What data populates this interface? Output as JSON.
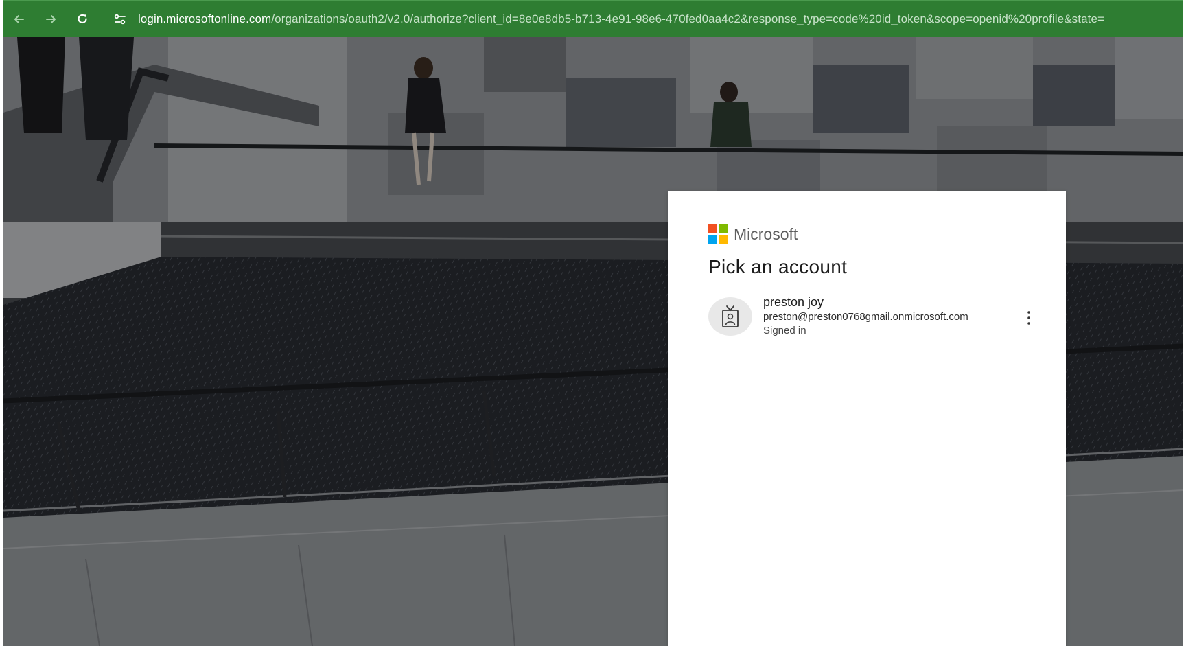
{
  "browser": {
    "url_host": "login.microsoftonline.com",
    "url_rest": "/organizations/oauth2/v2.0/authorize?client_id=8e0e8db5-b713-4e91-98e6-470fed0aa4c2&response_type=code%20id_token&scope=openid%20profile&state="
  },
  "signin": {
    "brand": "Microsoft",
    "heading": "Pick an account",
    "account": {
      "name": "preston joy",
      "email": "preston@preston0768gmail.onmicrosoft.com",
      "status": "Signed in"
    }
  },
  "colors": {
    "toolbar": "#2e7d32",
    "logo_red": "#f25022",
    "logo_green": "#7fba00",
    "logo_blue": "#00a4ef",
    "logo_yellow": "#ffb900"
  },
  "icons": {
    "back": "arrow-left-icon",
    "forward": "arrow-right-icon",
    "reload": "reload-icon",
    "site_info": "tune-icon",
    "avatar": "badge-person-icon",
    "more": "more-vertical-icon"
  }
}
